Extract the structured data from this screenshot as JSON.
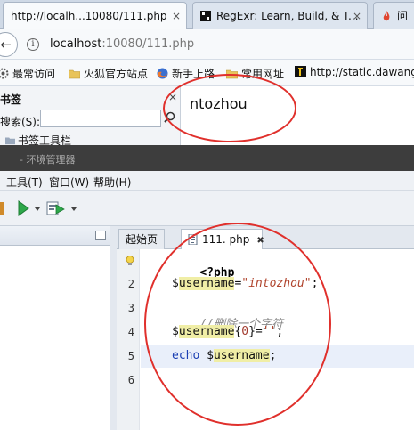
{
  "browser": {
    "tabs": [
      {
        "label": "http://localh...10080/111.php",
        "active": true
      },
      {
        "label": "RegExr: Learn, Build, & T...",
        "active": false
      },
      {
        "label": "问",
        "active": false
      }
    ],
    "close_glyph": "×",
    "url_host": "localhost",
    "url_rest": ":10080/111.php",
    "bookmarks": [
      {
        "label": "最常访问",
        "icon": "gear-icon"
      },
      {
        "label": "火狐官方站点",
        "icon": "folder-icon"
      },
      {
        "label": "新手上路",
        "icon": "firefox-icon"
      },
      {
        "label": "常用网址",
        "icon": "folder-icon"
      },
      {
        "label": "http://static.dawang",
        "icon": "page-icon"
      }
    ]
  },
  "sidebar": {
    "title": "书签",
    "search_label": "搜索(S):",
    "search_value": "",
    "toolbar_item": "书签工具栏"
  },
  "page": {
    "output_text": "ntozhou"
  },
  "editor": {
    "window_title": "- 环境管理器",
    "menu": [
      "工具(T)",
      "窗口(W)",
      "帮助(H)"
    ],
    "tabs": [
      {
        "label": "起始页",
        "active": false
      },
      {
        "label": "111. php",
        "active": true
      }
    ],
    "line_numbers": [
      "",
      "2",
      "3",
      "4",
      "5",
      "6"
    ],
    "code": {
      "line1": "<?php",
      "var": "username",
      "str": "\"intozhou\"",
      "comment": "//删除一个字符",
      "index": "0",
      "empty_str": "''",
      "echo": "echo"
    }
  },
  "colors": {
    "annotation": "#e0302c",
    "highlight": "#f0eea6",
    "current_line": "#e9effa"
  }
}
